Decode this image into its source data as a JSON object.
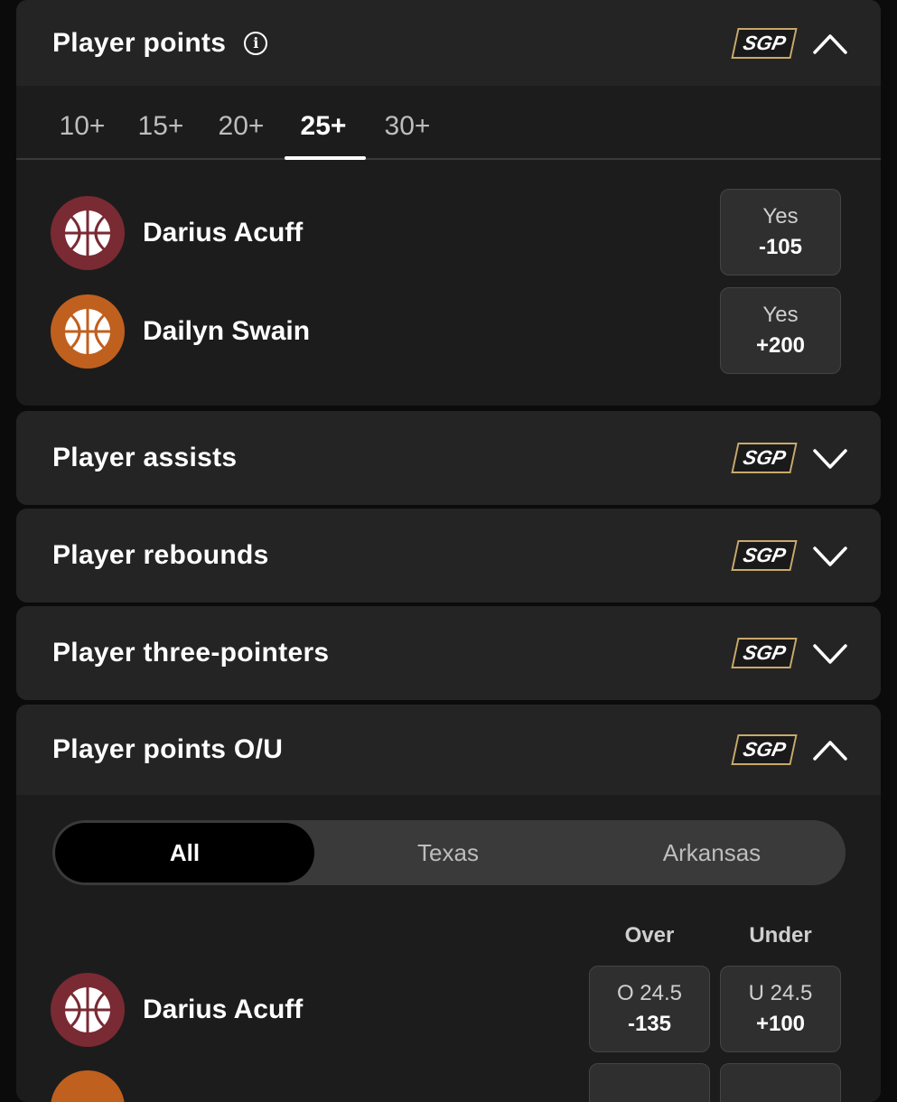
{
  "player_points": {
    "title": "Player points",
    "sgp": "SGP",
    "tabs": [
      "10+",
      "15+",
      "20+",
      "25+",
      "30+"
    ],
    "active_tab": "25+",
    "players": [
      {
        "name": "Darius Acuff",
        "bet_label": "Yes",
        "odds": "-105",
        "color": "#7a2a33"
      },
      {
        "name": "Dailyn Swain",
        "bet_label": "Yes",
        "odds": "+200",
        "color": "#c0601e"
      }
    ]
  },
  "collapsed_sections": [
    {
      "title": "Player assists",
      "sgp": "SGP"
    },
    {
      "title": "Player rebounds",
      "sgp": "SGP"
    },
    {
      "title": "Player three-pointers",
      "sgp": "SGP"
    }
  ],
  "player_points_ou": {
    "title": "Player points O/U",
    "sgp": "SGP",
    "filters": [
      "All",
      "Texas",
      "Arkansas"
    ],
    "active_filter": "All",
    "columns": [
      "Over",
      "Under"
    ],
    "rows": [
      {
        "name": "Darius Acuff",
        "over_line": "O 24.5",
        "over_odds": "-135",
        "under_line": "U 24.5",
        "under_odds": "+100"
      }
    ]
  },
  "icons": {
    "info": "info-icon",
    "chevron_up": "chevron-up-icon",
    "chevron_down": "chevron-down-icon",
    "avatar": "basketball-icon"
  },
  "colors": {
    "background": "#0b0b0b",
    "card": "#1c1c1c",
    "header": "#242424",
    "sgp_border": "#c9a96b"
  }
}
